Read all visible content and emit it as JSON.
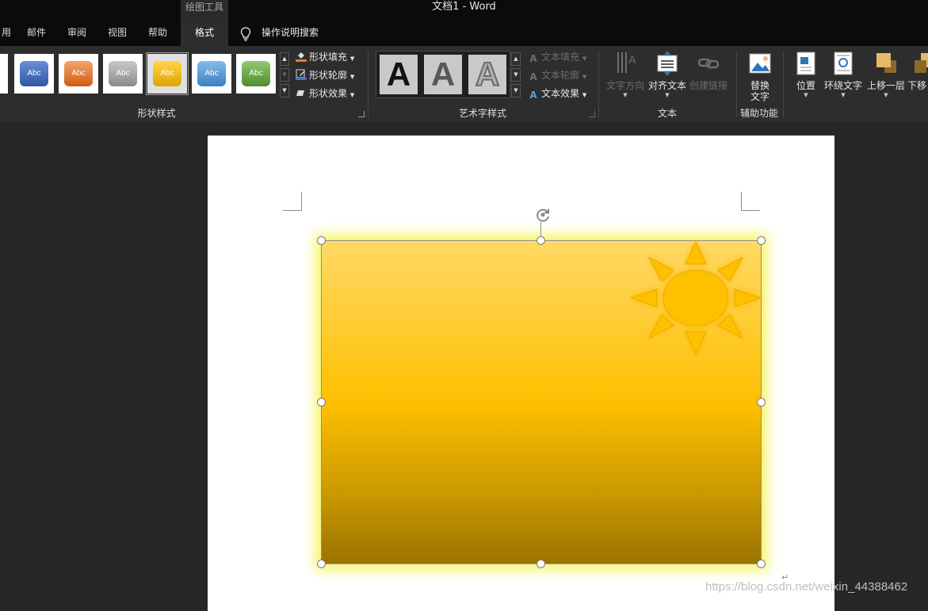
{
  "window": {
    "context_tab_group": "绘图工具",
    "title": "文档1  -  Word"
  },
  "tabs": [
    {
      "label": "用"
    },
    {
      "label": "邮件"
    },
    {
      "label": "审阅"
    },
    {
      "label": "视图"
    },
    {
      "label": "帮助"
    },
    {
      "label": "格式"
    }
  ],
  "search": {
    "label": "操作说明搜索",
    "icon": "lightbulb-icon"
  },
  "shape_styles": {
    "group_label": "形状样式",
    "gallery": [
      {
        "text": "",
        "color": "#111111"
      },
      {
        "text": "Abc",
        "color": "#4472c4"
      },
      {
        "text": "Abc",
        "color": "#ed7d31"
      },
      {
        "text": "Abc",
        "color": "#a5a5a5"
      },
      {
        "text": "Abc",
        "color": "#ffc000",
        "selected": true
      },
      {
        "text": "Abc",
        "color": "#5b9bd5"
      },
      {
        "text": "Abc",
        "color": "#70ad47"
      }
    ],
    "commands": [
      {
        "label": "形状填充",
        "icon": "paint-bucket-icon"
      },
      {
        "label": "形状轮廓",
        "icon": "pen-outline-icon"
      },
      {
        "label": "形状效果",
        "icon": "shape-effects-icon"
      }
    ]
  },
  "wordart_styles": {
    "group_label": "艺术字样式",
    "gallery": [
      {
        "letter": "A"
      },
      {
        "letter": "A"
      },
      {
        "letter": "A"
      }
    ],
    "commands": [
      {
        "label": "文本填充",
        "disabled": true
      },
      {
        "label": "文本轮廓",
        "disabled": true
      },
      {
        "label": "文本效果",
        "disabled": false
      }
    ]
  },
  "text_group": {
    "group_label": "文本",
    "text_direction": "文字方向",
    "align_text": "对齐文本",
    "create_link": "创建链接"
  },
  "accessibility_group": {
    "group_label": "辅助功能",
    "alt_text_line1": "替换",
    "alt_text_line2": "文字"
  },
  "arrange_group": {
    "position": "位置",
    "wrap_text": "环绕文字",
    "bring_forward": "上移一层",
    "send_backward": "下移"
  },
  "document": {
    "paragraph_mark": "↵",
    "watermark": "https://blog.csdn.net/weixin_44388462"
  },
  "colors": {
    "shape_gradient_top": "#ffd966",
    "shape_gradient_bottom": "#9b7300",
    "glow": "#f6f25a",
    "sun": "#ffc000"
  }
}
